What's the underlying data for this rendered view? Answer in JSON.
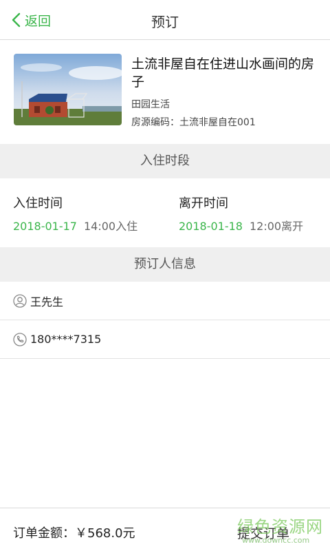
{
  "header": {
    "back_label": "返回",
    "title": "预订"
  },
  "listing": {
    "title": "土流非屋自在住进山水画间的房子",
    "category": "田园生活",
    "code": "房源编码：土流非屋自在001"
  },
  "stay": {
    "section_title": "入住时段",
    "checkin": {
      "label": "入住时间",
      "date": "2018-01-17",
      "time": "14:00入住"
    },
    "checkout": {
      "label": "离开时间",
      "date": "2018-01-18",
      "time": "12:00离开"
    }
  },
  "booker": {
    "section_title": "预订人信息",
    "name": "王先生",
    "phone": "180****7315"
  },
  "footer": {
    "total": "订单金额：￥568.0元",
    "submit_label": "提交订单"
  },
  "watermark": {
    "main": "绿色资源网",
    "sub": "www.downcc.com"
  },
  "colors": {
    "accent": "#3ab54a",
    "section_bg": "#efefef"
  },
  "icons": [
    "back-chevron-icon",
    "user-icon",
    "phone-icon"
  ]
}
